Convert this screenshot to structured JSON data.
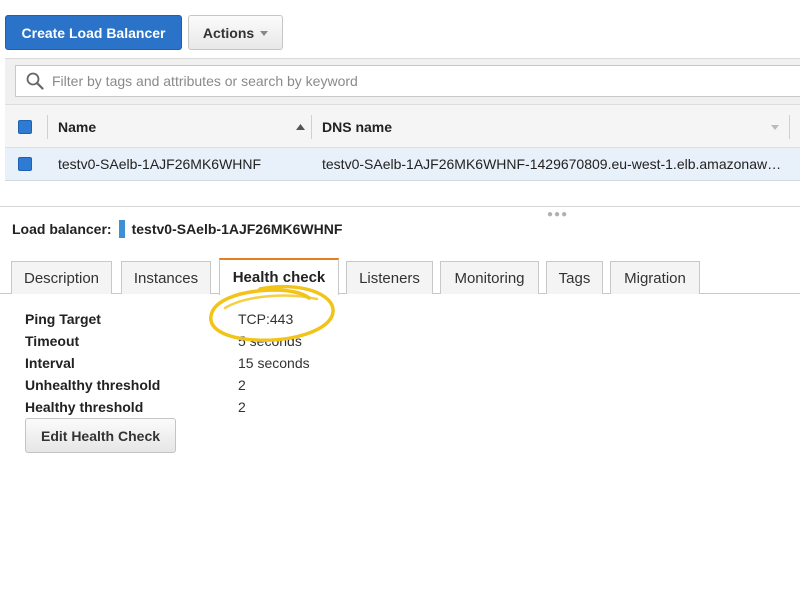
{
  "toolbar": {
    "create_label": "Create Load Balancer",
    "actions_label": "Actions"
  },
  "search": {
    "placeholder": "Filter by tags and attributes or search by keyword"
  },
  "table": {
    "columns": [
      "Name",
      "DNS name"
    ],
    "rows": [
      {
        "name": "testv0-SAelb-1AJF26MK6WHNF",
        "dns": "testv0-SAelb-1AJF26MK6WHNF-1429670809.eu-west-1.elb.amazonaw…"
      }
    ]
  },
  "detail": {
    "title_prefix": "Load balancer:",
    "title_name": "testv0-SAelb-1AJF26MK6WHNF",
    "tabs": [
      "Description",
      "Instances",
      "Health check",
      "Listeners",
      "Monitoring",
      "Tags",
      "Migration"
    ],
    "active_tab": "Health check",
    "fields": [
      {
        "label": "Ping Target",
        "value": "TCP:443"
      },
      {
        "label": "Timeout",
        "value": "5 seconds"
      },
      {
        "label": "Interval",
        "value": "15 seconds"
      },
      {
        "label": "Unhealthy threshold",
        "value": "2"
      },
      {
        "label": "Healthy threshold",
        "value": "2"
      }
    ],
    "edit_button": "Edit Health Check"
  },
  "colors": {
    "primary": "#2b73c8",
    "active_tab_accent": "#e67e22",
    "annotation": "#f2c318",
    "selected_row": "#e8f0fa"
  },
  "icons": {
    "search": "search-icon",
    "actions_caret": "chevron-down-icon",
    "sort": "sort-up-icon"
  }
}
